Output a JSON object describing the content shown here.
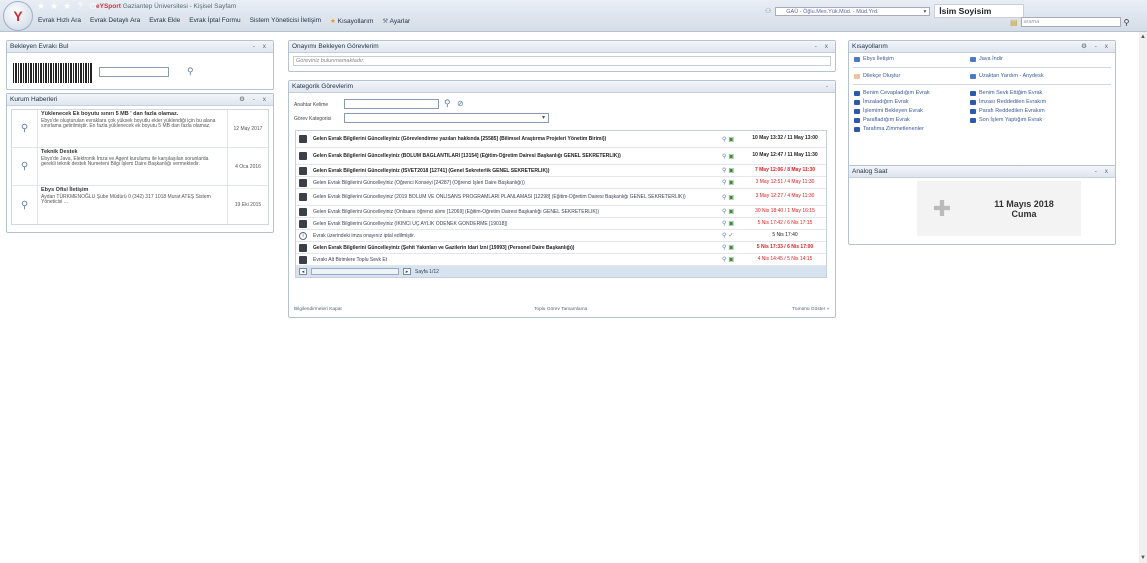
{
  "header": {
    "app_title_brand": "eYSport",
    "app_title": "Gaziantep Üniversitesi - Kişisel Sayfam",
    "menu": [
      "Evrak Hızlı Ara",
      "Evrak Detaylı Ara",
      "Evrak Ekle",
      "Evrak İptal Formu",
      "Sistem Yöneticisi İletişim",
      "Kısayollarım",
      "Ayarlar"
    ],
    "role": "GAÜ - Öğlu.Mes.Yük.Müd. - Müd.Yrd.",
    "user_name": "İsim Soyisim",
    "search_placeholder": "arama"
  },
  "barcode_panel": {
    "title": "Bekleyen Evrakı Bul",
    "controls": "- x"
  },
  "news_panel": {
    "title": "Kurum Haberleri",
    "controls": "⚙ - x",
    "items": [
      {
        "title": "Yüklenecek Ek boyutu sınırı 5 MB ' dan fazla olamaz.",
        "body": "Ebys'de oluşturulan evraklara çok yüksek boyutlu ekler yüklendiği için bu alana sınırlama getirilmiştir. En fazla yüklenecek ek boyutu 5 MB dan fazla olamaz.",
        "date": "12 May 2017"
      },
      {
        "title": "Teknik Destek",
        "body": "Ebys'de Java, Elektronik İmza ve Agent kurulumu ile karşılaşılan sorunlarda gerekli teknik destek Numeteni Bilgi İşlem Daire Başkanlığı vermektedir.",
        "date": "4 Oca 2016"
      },
      {
        "title": "Ebys Ofisi İletişim",
        "body": "Aydan TÜRKMENOĞLU Şube Müdürü 0 (342) 317 1018 Murat ATEŞ Sistem Yöneticisi ...",
        "date": "19 Eki 2015"
      }
    ]
  },
  "approval_panel": {
    "title": "Onayımı Bekleyen Görevlerim",
    "controls": "- x",
    "message": "Göreviniz bulunmamaktadır."
  },
  "tasks_panel": {
    "title": "Kategorik Görevlerim",
    "controls": "-",
    "keyword_label": "Anahtar Kelime",
    "category_label": "Görev Kategorisi",
    "rows": [
      {
        "icon": "edit",
        "text": "Gelen Evrak Bilgilerini Güncelleyiniz (Görevlendirme yazıları hakkında [25585] (Bilimsel Araştırma Projeleri Yönetim Birimi))",
        "date": "10 May 13:32 / 11 May 13:00",
        "bold": true,
        "color": "bk",
        "tall": true
      },
      {
        "icon": "edit",
        "text": "Gelen Evrak Bilgilerini Güncelleyiniz (BÖLÜM BAĞLANTILARI [13154] (Eğitim-Öğretim Dairesi Başkanlığı GENEL SEKRETERLİK))",
        "date": "10 May 12:47 / 11 May 11:30",
        "bold": true,
        "color": "bk",
        "tall": true
      },
      {
        "icon": "edit",
        "text": "Gelen Evrak Bilgilerini Güncelleyiniz (ISVET2018 [12741] (Genel Sekreterlik GENEL SEKRETERLİK))",
        "date": "7 May 12:06 / 8 May 11:30",
        "bold": true,
        "color": "red",
        "tall": false
      },
      {
        "icon": "edit",
        "text": "Gelen Evrak Bilgilerini Güncelleyiniz (Öğrenci Konseyi [24287] (Öğrenci İşleri Daire Başkanlığı))",
        "date": "3 May 12:51 / 4 May 11:30",
        "bold": false,
        "color": "red",
        "tall": false
      },
      {
        "icon": "edit",
        "text": "Gelen Evrak Bilgilerini Güncelleyiniz (2019 BÖLÜM VE ÖNLİSANS PROGRAMLARI PLANLAMASI [12298] (Eğitim-Öğretim Dairesi Başkanlığı GENEL SEKRETERLİK))",
        "date": "3 May 12:27 / 4 May 11:30",
        "bold": false,
        "color": "red",
        "tall": true
      },
      {
        "icon": "edit",
        "text": "Gelen Evrak Bilgilerini Güncelleyiniz (Önlisans öğrenci alımı [12069] (Eğitim-Öğretim Dairesi Başkanlığı GENEL SEKRETERLİK))",
        "date": "30 Nis 18:40 / 1 May 16:15",
        "bold": false,
        "color": "red",
        "tall": false
      },
      {
        "icon": "edit",
        "text": "Gelen Evrak Bilgilerini Güncelleyiniz (İKİNCİ ÜÇ AYLIK ÖDENEK GÖNDERME [19018])",
        "date": "5 Nis 17:42 / 6 Nis 17:15",
        "bold": false,
        "color": "red",
        "tall": false
      },
      {
        "icon": "info",
        "text": "Evrak üzerindeki imza onayınız iptal edilmiştir.",
        "date": "5 Nis 17:40",
        "bold": false,
        "color": "bk",
        "tall": false
      },
      {
        "icon": "edit",
        "text": "Gelen Evrak Bilgilerini Güncelleyiniz (Şehit Yakınları ve Gazilerin İdari İzni [19993] (Personel Daire Başkanlığı))",
        "date": "5 Nis 17:33 / 6 Nis 17:00",
        "bold": true,
        "color": "red",
        "tall": false
      },
      {
        "icon": "edit",
        "text": "Evrakı Alt Birimlere Toplu Sevk Et",
        "date": "4 Nis 14:45 / 5 Nis 14:15",
        "bold": false,
        "color": "red",
        "tall": false
      }
    ],
    "pager_text": "Sayfa 1/12",
    "footer_left": "Bilgilendirmeleri Kapat",
    "footer_center": "Toplu Görev Tamamlama",
    "footer_right": "Tümünü Göster »"
  },
  "shortcuts_panel": {
    "title": "Kısayollarım",
    "controls": "⚙ - x",
    "top_links": [
      "Ebys İletişim",
      "Java İndir",
      "Dilekçe Oluştur",
      "Uzaktan Yardım - Anydesk"
    ],
    "links": [
      "Benim Cevapladığım Evrak",
      "Benim Sevk Ettiğim Evrak",
      "İmzaladığım Evrak",
      "İmzası Reddedilen Evrakım",
      "İşlemimi Bekleyen Evrak",
      "Parafı Reddedilen Evrakım",
      "Parafladığım Evrak",
      "Son İşlem Yaptığım Evrak",
      "Tarafıma Zimmetlenenler"
    ]
  },
  "clock_panel": {
    "title": "Analog Saat",
    "controls": "- x",
    "date": "11 Mayıs 2018",
    "day": "Cuma"
  }
}
